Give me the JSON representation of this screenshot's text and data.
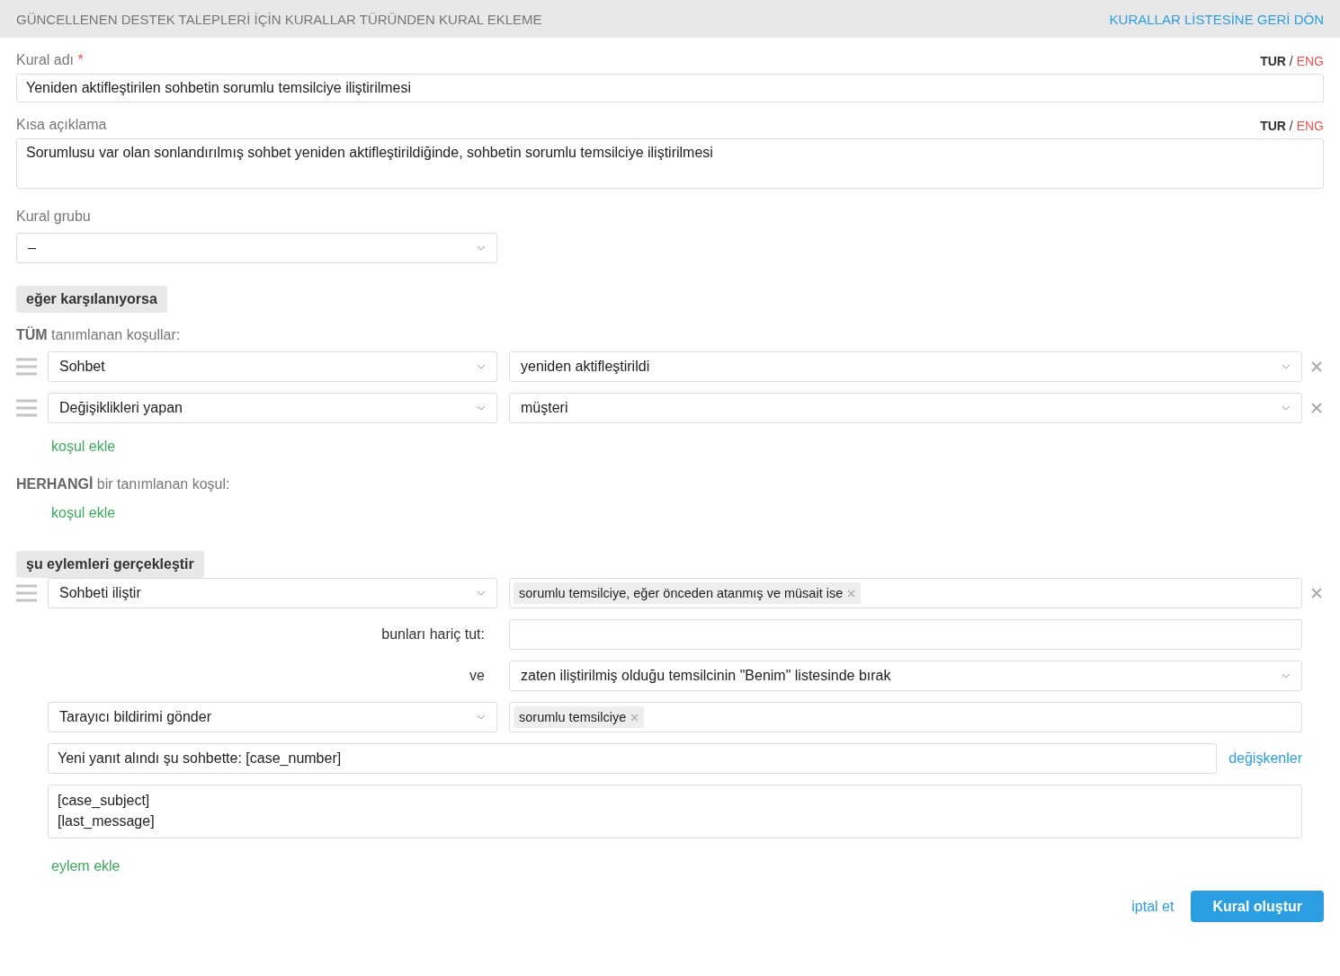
{
  "header": {
    "title": "GÜNCELLENEN DESTEK TALEPLERİ İÇİN KURALLAR TÜRÜNDEN KURAL EKLEME",
    "back_link": "KURALLAR LİSTESİNE GERİ DÖN"
  },
  "name_field": {
    "label": "Kural adı",
    "required_mark": "*",
    "languages": [
      {
        "label": "TUR",
        "selected": true
      },
      {
        "label": "ENG",
        "selected": false
      }
    ],
    "separator": "/",
    "value": "Yeniden aktifleştirilen sohbetin sorumlu temsilciye iliştirilmesi"
  },
  "description_field": {
    "label": "Kısa açıklama",
    "languages": [
      {
        "label": "TUR",
        "selected": true
      },
      {
        "label": "ENG",
        "selected": false
      }
    ],
    "separator": "/",
    "value": "Sorumlusu var olan sonlandırılmış sohbet yeniden aktifleştirildiğinde, sohbetin sorumlu temsilciye iliştirilmesi"
  },
  "rule_group": {
    "label": "Kural grubu",
    "value": "–"
  },
  "conditions_button": "eğer karşılanıyorsa",
  "all_conditions": {
    "heading": "**TÜM** tanımlanan koşullar:",
    "rows": [
      {
        "field": "Sohbet",
        "value": "yeniden aktifleştirildi"
      },
      {
        "field": "Değişiklikleri yapan",
        "value": "müşteri"
      }
    ],
    "add_link": "koşul ekle"
  },
  "any_conditions": {
    "heading": "**HERHANGİ** bir tanımlanan koşul:",
    "add_link": "koşul ekle"
  },
  "actions_button": "şu eylemleri gerçekleştir",
  "actions": [
    {
      "kind": "attach",
      "action": "Sohbeti iliştir",
      "tags": [
        "sorumlu temsilciye, eğer önceden atanmış ve müsait ise"
      ],
      "exclude_label": "bunları hariç tut:",
      "and_label": "ve",
      "and_value": "zaten iliştirilmiş olduğu temsilcinin \"Benim\" listesinde bırak"
    },
    {
      "kind": "notify",
      "action": "Tarayıcı bildirimi gönder",
      "tags": [
        "sorumlu temsilciye"
      ],
      "subject": "Yeni yanıt alındı şu sohbette: [case_number]",
      "variables_link": "değişkenler",
      "body": "[case_subject]\n[last_message]"
    }
  ],
  "add_action": "eylem ekle",
  "footer": {
    "cancel": "iptal et",
    "submit": "Kural oluştur"
  }
}
